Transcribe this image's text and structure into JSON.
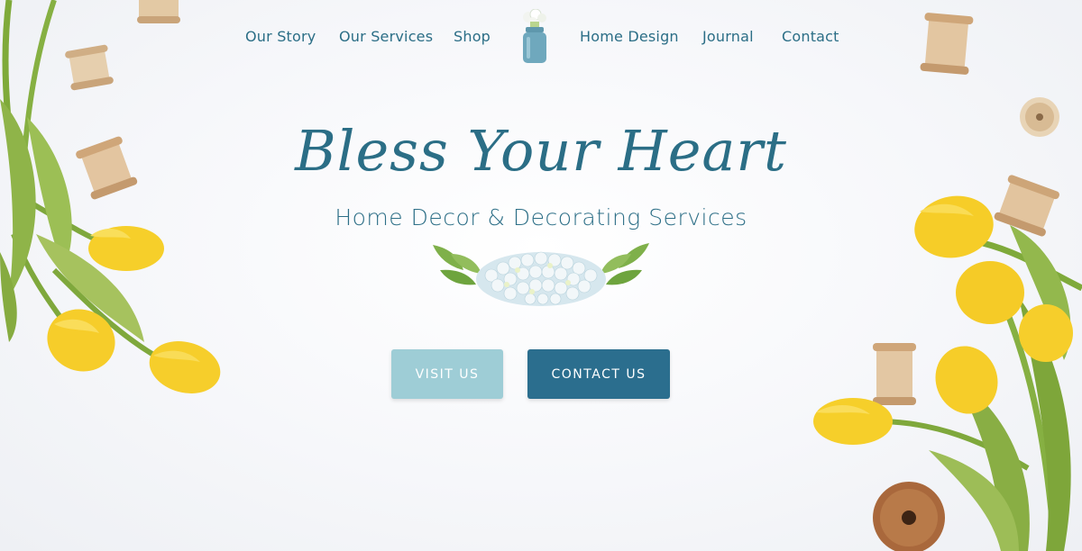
{
  "nav": {
    "items": [
      "Our Story",
      "Our Services",
      "Shop",
      "Home Design",
      "Journal",
      "Contact"
    ]
  },
  "logo": {
    "script_text": "Bless Your Heart",
    "subtitle": "Home Decor & Decorating Services"
  },
  "buttons": {
    "visit": "VISIT US",
    "contact": "CONTACT US"
  },
  "colors": {
    "brand": "#2b6e86",
    "button_light": "#9ecdd6",
    "button_dark": "#2b6e8e",
    "tulip": "#f6cf2a",
    "stem": "#7faa3a"
  },
  "icons": [
    "mason-jar-icon",
    "hydrangea-icon"
  ]
}
